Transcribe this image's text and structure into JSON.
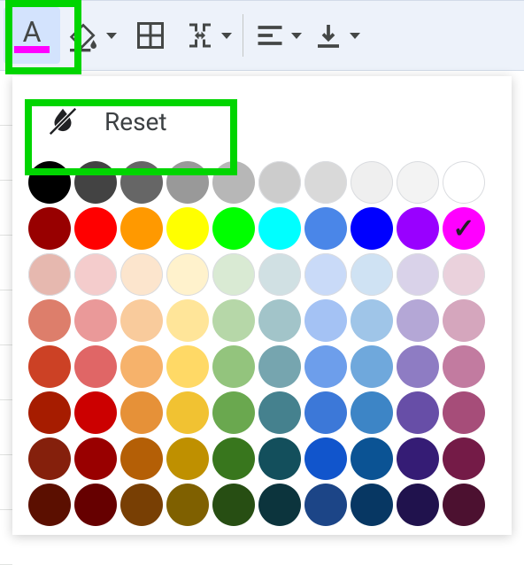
{
  "toolbar": {
    "text_color_letter": "A",
    "text_color_current": "#ff00ff"
  },
  "popup": {
    "reset_label": "Reset",
    "selected_color": "#ff00ff",
    "swatches": [
      [
        "#000000",
        "#434343",
        "#666666",
        "#999999",
        "#b7b7b7",
        "#cccccc",
        "#d9d9d9",
        "#efefef",
        "#f3f3f3",
        "#ffffff"
      ],
      [
        "#980000",
        "#ff0000",
        "#ff9900",
        "#ffff00",
        "#00ff00",
        "#00ffff",
        "#4a86e8",
        "#0000ff",
        "#9900ff",
        "#ff00ff"
      ],
      [
        "#e6b8af",
        "#f4cccc",
        "#fce5cd",
        "#fff2cc",
        "#d9ead3",
        "#d0e0e3",
        "#c9daf8",
        "#cfe2f3",
        "#d9d2e9",
        "#ead1dc"
      ],
      [
        "#dd7e6b",
        "#ea9999",
        "#f9cb9c",
        "#ffe599",
        "#b6d7a8",
        "#a2c4c9",
        "#a4c2f4",
        "#9fc5e8",
        "#b4a7d6",
        "#d5a6bd"
      ],
      [
        "#cc4125",
        "#e06666",
        "#f6b26b",
        "#ffd966",
        "#93c47d",
        "#76a5af",
        "#6d9eeb",
        "#6fa8dc",
        "#8e7cc3",
        "#c27ba0"
      ],
      [
        "#a61c00",
        "#cc0000",
        "#e69138",
        "#f1c232",
        "#6aa84f",
        "#45818e",
        "#3c78d8",
        "#3d85c6",
        "#674ea7",
        "#a64d79"
      ],
      [
        "#85200c",
        "#990000",
        "#b45f06",
        "#bf9000",
        "#38761d",
        "#134f5c",
        "#1155cc",
        "#0b5394",
        "#351c75",
        "#741b47"
      ],
      [
        "#5b0f00",
        "#660000",
        "#783f04",
        "#7f6000",
        "#274e13",
        "#0c343d",
        "#1c4587",
        "#073763",
        "#20124d",
        "#4c1130"
      ]
    ]
  }
}
